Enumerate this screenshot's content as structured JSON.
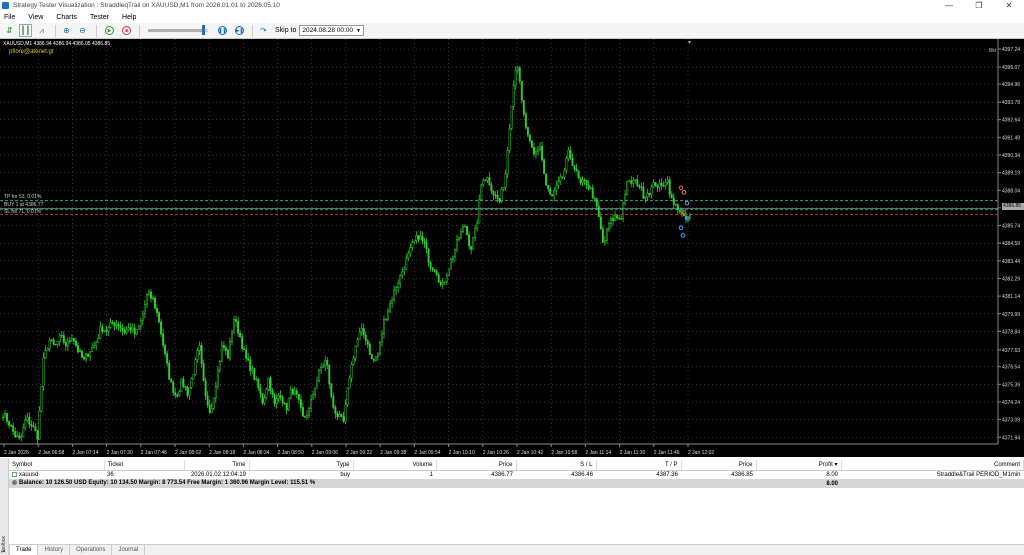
{
  "window": {
    "title": "Strategy Tester Visualization : StraddleqTrail on XAUUSD,M1 from 2026.01.01 to 2026.05.10",
    "minimize": "—",
    "maximize": "❐",
    "close": "✕"
  },
  "menu": [
    "File",
    "View",
    "Charts",
    "Tester",
    "Help"
  ],
  "toolbar": {
    "skip_label": "Skip to",
    "skip_value": "2024.08.28 00:00",
    "speed": 0.92
  },
  "chart": {
    "symbol_info": "XAUUSD,M1  4386.94 4386.94 4386.05 4386.85",
    "watermark": "pfiore@atenet.gr",
    "tp_label": "TP for 53, 0.01%",
    "buy_label": "BUY 1 at 4386.77",
    "sl_label": "SL for 71, 0.01%",
    "corner_label": "Bkt",
    "current_price": "4386.85",
    "background": "#000000",
    "bull_color": "#2fd22f",
    "bear_color": "#2fd22f",
    "grid_color": "#555555"
  },
  "chart_data": {
    "type": "candlestick",
    "y_ticks": [
      "4397.24",
      "4396.07",
      "4394.96",
      "4393.78",
      "4392.64",
      "4391.49",
      "4390.34",
      "4389.19",
      "4388.04",
      "4386.89",
      "4385.74",
      "4384.59",
      "4383.44",
      "4382.29",
      "4381.14",
      "4379.99",
      "4378.84",
      "4377.63",
      "4376.54",
      "4375.39",
      "4374.24",
      "4373.09",
      "4371.94"
    ],
    "x_ticks": [
      "2 Jan 2026",
      "2 Jan 06:58",
      "2 Jan 07:14",
      "2 Jan 07:30",
      "2 Jan 07:46",
      "2 Jan 08:02",
      "2 Jan 08:18",
      "2 Jan 08:34",
      "2 Jan 08:50",
      "2 Jan 09:06",
      "2 Jan 09:22",
      "2 Jan 09:38",
      "2 Jan 09:54",
      "2 Jan 10:10",
      "2 Jan 10:26",
      "2 Jan 10:42",
      "2 Jan 10:58",
      "2 Jan 11:14",
      "2 Jan 11:30",
      "2 Jan 11:46",
      "2 Jan 12:02"
    ],
    "ylim": [
      4371.5,
      4397.9
    ],
    "close_path": [
      4373.5,
      4372.9,
      4372.1,
      4371.7,
      4373.2,
      4372.7,
      4372.0,
      4376.9,
      4378.3,
      4377.8,
      4378.5,
      4377.9,
      4378.6,
      4377.6,
      4376.9,
      4377.6,
      4378.0,
      4379.1,
      4378.9,
      4379.4,
      4379.3,
      4378.8,
      4379.1,
      4378.6,
      4379.6,
      4381.3,
      4380.9,
      4379.6,
      4377.4,
      4375.5,
      4374.6,
      4375.6,
      4374.8,
      4376.2,
      4377.9,
      4374.6,
      4373.6,
      4375.8,
      4378.0,
      4377.2,
      4379.7,
      4378.6,
      4377.1,
      4376.4,
      4375.4,
      4374.2,
      4375.8,
      4374.0,
      4374.9,
      4373.7,
      4375.1,
      4374.5,
      4373.1,
      4373.7,
      4375.2,
      4376.4,
      4377.0,
      4374.1,
      4373.3,
      4372.9,
      4375.9,
      4377.8,
      4378.9,
      4378.3,
      4376.8,
      4377.4,
      4379.5,
      4380.6,
      4381.7,
      4382.6,
      4383.6,
      4384.5,
      4385.1,
      4384.5,
      4383.2,
      4382.9,
      4381.6,
      4382.8,
      4383.9,
      4385.0,
      4385.8,
      4384.2,
      4385.6,
      4388.9,
      4388.8,
      4387.8,
      4387.3,
      4388.9,
      4393.4,
      4396.7,
      4393.3,
      4391.3,
      4390.3,
      4391.0,
      4388.4,
      4387.5,
      4388.3,
      4389.0,
      4390.5,
      4389.5,
      4388.4,
      4388.6,
      4387.9,
      4386.7,
      4384.4,
      4385.9,
      4386.3,
      4386.2,
      4388.4,
      4388.6,
      4388.5,
      4387.7,
      4388.0,
      4388.5,
      4388.2,
      4388.9,
      4387.1,
      4386.9,
      4386.1,
      4386.3
    ],
    "positions": [
      {
        "symbol": "xauusd",
        "ticket": "36",
        "time": "2026.01.02 12:04:19",
        "type": "buy",
        "volume": "1",
        "price": "4386.77",
        "sl": "4386.46",
        "tp": "4387.36",
        "current": "4386.85",
        "profit": "8.00",
        "comment": "Straddle&Trail PERIOD_M1min"
      }
    ]
  },
  "trade": {
    "columns": [
      "Symbol",
      "Ticket",
      "Time",
      "Type",
      "Volume",
      "Price",
      "S / L",
      "T / P",
      "Price",
      "Profit",
      "Comment"
    ],
    "sort_indicator": "▾",
    "balance_text": "Balance: 10 126.50 USD  Equity: 10 134.50  Margin: 8 773.54  Free Margin: 1 360.96  Margin Level: 115.51 %",
    "balance_profit": "8.00",
    "tabs": [
      "Trade",
      "History",
      "Operations",
      "Journal"
    ],
    "side_tab": "Toolbox",
    "close_glyph": "✕"
  }
}
